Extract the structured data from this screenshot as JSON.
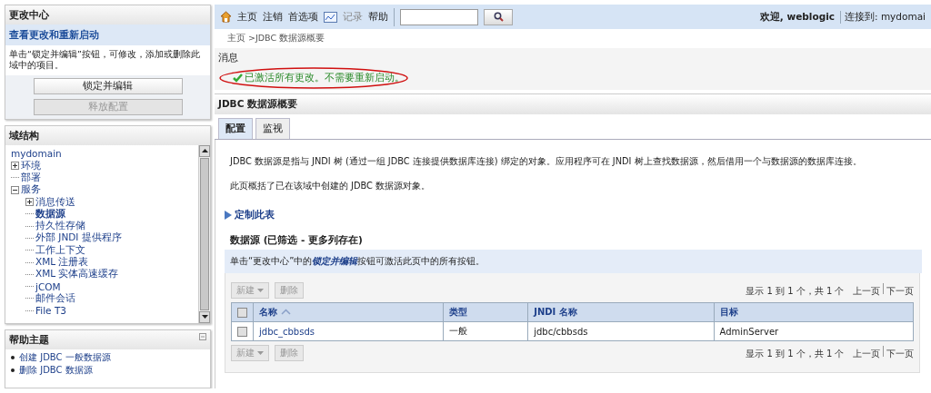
{
  "change_center": {
    "title": "更改中心",
    "link": "查看更改和重新启动",
    "description": "单击“锁定并编辑”按钮，可修改，添加或删除此域中的项目。",
    "buttons": [
      {
        "label": "锁定并编辑",
        "disabled": false
      },
      {
        "label": "释放配置",
        "disabled": true
      }
    ]
  },
  "domain_structure": {
    "title": "域结构",
    "root": "mydomain",
    "tree": [
      {
        "label": "环境",
        "expanded": false,
        "selected": false
      },
      {
        "label": "部署",
        "selected": false
      },
      {
        "label": "服务",
        "expanded": true,
        "selected": false,
        "children": [
          {
            "label": "消息传送",
            "expanded": false,
            "selected": false
          },
          {
            "label": "数据源",
            "selected": true
          },
          {
            "label": "持久性存储",
            "selected": false
          },
          {
            "label": "外部 JNDI 提供程序",
            "selected": false
          },
          {
            "label": "工作上下文",
            "selected": false
          },
          {
            "label": "XML 注册表",
            "selected": false
          },
          {
            "label": "XML 实体高速缓存",
            "selected": false
          },
          {
            "label": "jCOM",
            "selected": false
          },
          {
            "label": "邮件会话",
            "selected": false
          },
          {
            "label": "File T3",
            "selected": false
          }
        ]
      }
    ]
  },
  "help_topics": {
    "title": "帮助主题",
    "items": [
      "创建 JDBC 一般数据源",
      "删除 JDBC 数据源"
    ]
  },
  "toolbar": {
    "items": [
      {
        "label": "主页",
        "disabled": false
      },
      {
        "label": "注销",
        "disabled": false
      },
      {
        "label": "首选项",
        "disabled": false
      },
      {
        "label": "记录",
        "disabled": true
      },
      {
        "label": "帮助",
        "disabled": false
      }
    ],
    "welcome": "欢迎, weblogic",
    "connected": "连接到: mydomai"
  },
  "breadcrumb": "主页 >JDBC 数据源概要",
  "messages": {
    "title": "消息",
    "text": "已激活所有更改。不需要重新启动。"
  },
  "panel": {
    "title": "JDBC 数据源概要",
    "tabs": [
      {
        "label": "配置",
        "selected": true
      },
      {
        "label": "监视",
        "selected": false
      }
    ],
    "paragraphs": [
      "JDBC 数据源是指与 JNDI 树 (通过一组 JDBC 连接提供数据库连接) 绑定的对象。应用程序可在 JNDI 树上查找数据源，然后借用一个与数据源的数据库连接。",
      "此页概括了已在该域中创建的 JDBC 数据源对象。"
    ],
    "customize": "定制此表",
    "table_title": "数据源 (已筛选 - 更多列存在)",
    "notice": [
      "单击“更改中心”中的",
      "锁定并编辑",
      "按钮可激活此页中的所有按钮。"
    ],
    "controls": [
      {
        "actions": [
          {
            "label": "新建",
            "dropdown": true,
            "disabled": true
          },
          {
            "label": "删除",
            "dropdown": false,
            "disabled": true
          }
        ],
        "pagination": {
          "summary": "显示 1 到 1 个，共 1 个",
          "prev": "上一页",
          "next": "下一页"
        }
      },
      {
        "actions": [
          {
            "label": "新建",
            "dropdown": true,
            "disabled": true
          },
          {
            "label": "删除",
            "dropdown": false,
            "disabled": true
          }
        ],
        "pagination": {
          "summary": "显示 1 到 1 个，共 1 个",
          "prev": "上一页",
          "next": "下一页"
        }
      }
    ],
    "header_checked": false,
    "columns": [
      "名称",
      "类型",
      "JNDI 名称",
      "目标"
    ],
    "rows": [
      {
        "checked": false,
        "cells": [
          "jdbc_cbbsds",
          "一般",
          "jdbc/cbbsds",
          "AdminServer"
        ]
      }
    ]
  }
}
